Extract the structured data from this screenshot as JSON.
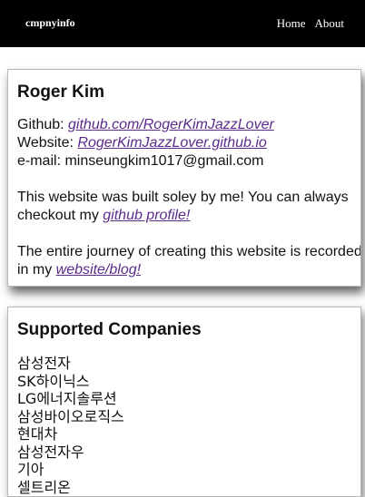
{
  "navbar": {
    "brand": "cmpnyinfo",
    "links": [
      "Home",
      "About"
    ]
  },
  "profile": {
    "name": "Roger Kim",
    "github_label": "Github: ",
    "github_link": "github.com/RogerKimJazzLover",
    "website_label": "Website: ",
    "website_link": "RogerKimJazzLover.github.io",
    "email_label": "e-mail: ",
    "email": "minseungkim1017@gmail.com",
    "para1_text": "This website was built soley by me! You can always checkout my ",
    "para1_link": "github profile!",
    "para2_text": "The entire journey of creating this website is recorded in my ",
    "para2_link": "website/blog!"
  },
  "companies": {
    "title": "Supported Companies",
    "items": [
      "삼성전자",
      "SK하이닉스",
      "LG에너지솔루션",
      "삼성바이오로직스",
      "현대차",
      "삼성전자우",
      "기아",
      "셀트리온"
    ]
  }
}
